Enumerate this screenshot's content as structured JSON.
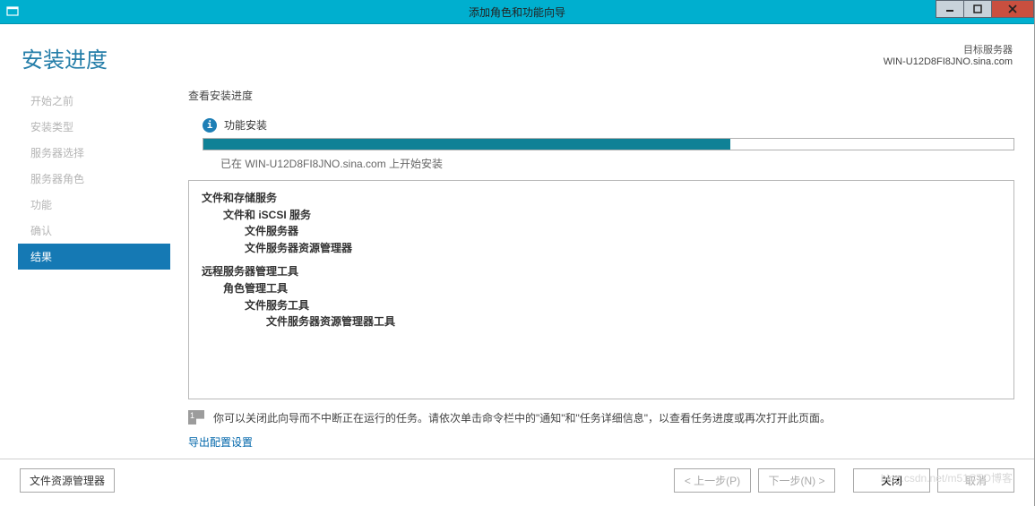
{
  "window": {
    "title": "添加角色和功能向导"
  },
  "header": {
    "page_title": "安装进度",
    "target_label": "目标服务器",
    "target_server": "WIN-U12D8FI8JNO.sina.com"
  },
  "nav": {
    "items": [
      {
        "label": "开始之前",
        "active": false
      },
      {
        "label": "安装类型",
        "active": false
      },
      {
        "label": "服务器选择",
        "active": false
      },
      {
        "label": "服务器角色",
        "active": false
      },
      {
        "label": "功能",
        "active": false
      },
      {
        "label": "确认",
        "active": false
      },
      {
        "label": "结果",
        "active": true
      }
    ]
  },
  "content": {
    "view_progress_label": "查看安装进度",
    "status_text": "功能安装",
    "progress_percent": 65,
    "install_target_text": "已在 WIN-U12D8FI8JNO.sina.com 上开始安装",
    "features": {
      "group1": {
        "l0": "文件和存储服务",
        "l1": "文件和 iSCSI 服务",
        "l2a": "文件服务器",
        "l2b": "文件服务器资源管理器"
      },
      "group2": {
        "l0": "远程服务器管理工具",
        "l1": "角色管理工具",
        "l2": "文件服务工具",
        "l3": "文件服务器资源管理器工具"
      }
    },
    "hint_text": "你可以关闭此向导而不中断正在运行的任务。请依次单击命令栏中的\"通知\"和\"任务详细信息\"，以查看任务进度或再次打开此页面。",
    "export_link": "导出配置设置"
  },
  "footer": {
    "secondary_button": "文件资源管理器",
    "prev": "< 上一步(P)",
    "next": "下一步(N) >",
    "close": "关闭",
    "cancel": "取消"
  },
  "watermark": "blog.csdn.net/m51CTO博客"
}
